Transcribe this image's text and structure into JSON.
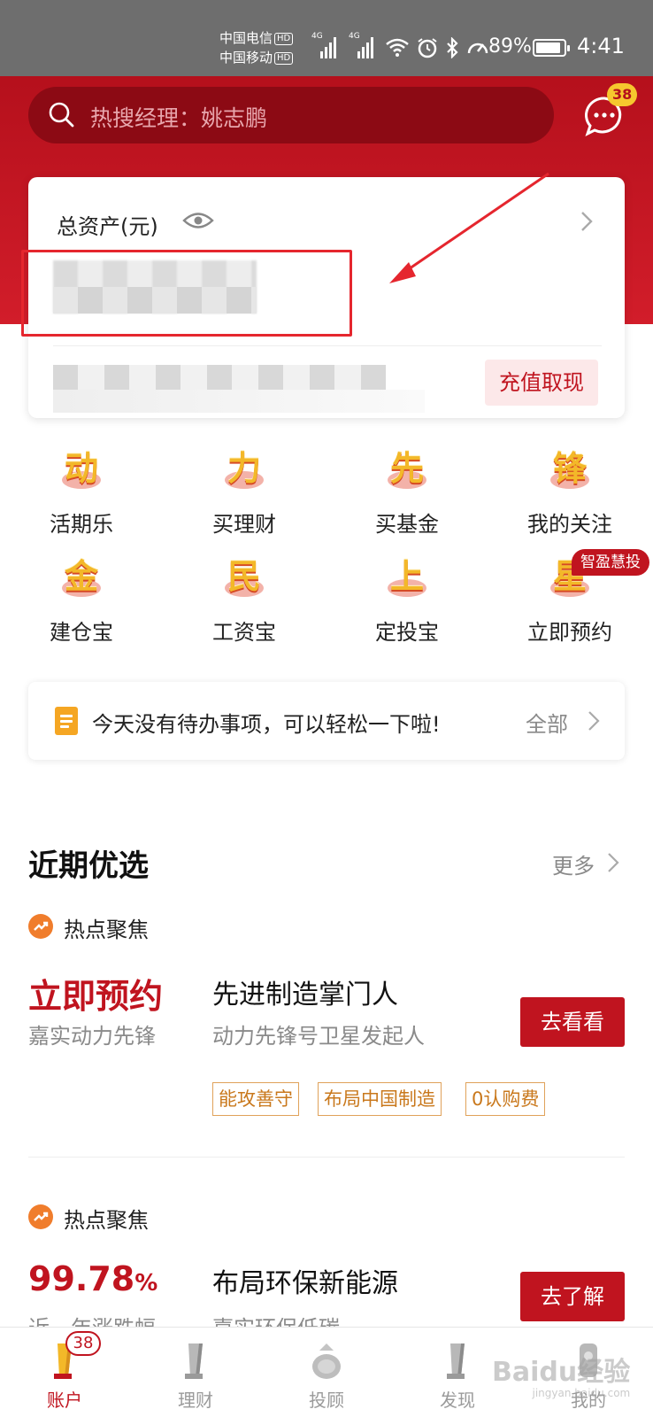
{
  "status_bar": {
    "carrier_1": "中国电信",
    "carrier_2": "中国移动",
    "hd_badge": "HD",
    "network": "4G",
    "battery_pct": "89%",
    "battery_level": 0.89,
    "time": "4:41"
  },
  "header": {
    "search_placeholder": "热搜经理：姚志鹏",
    "message_badge": "38",
    "bg_color": "#c4141f"
  },
  "asset_card": {
    "title": "总资产(元)",
    "recharge_label": "充值取现"
  },
  "shortcuts": [
    {
      "glyph": "动",
      "label": "活期乐"
    },
    {
      "glyph": "力",
      "label": "买理财"
    },
    {
      "glyph": "先",
      "label": "买基金"
    },
    {
      "glyph": "锋",
      "label": "我的关注"
    },
    {
      "glyph": "金",
      "label": "建仓宝"
    },
    {
      "glyph": "民",
      "label": "工资宝"
    },
    {
      "glyph": "上",
      "label": "定投宝"
    },
    {
      "glyph": "星",
      "label": "立即预约"
    }
  ],
  "shortcut_badge": "智盈慧投",
  "todo": {
    "text": "今天没有待办事项，可以轻松一下啦!",
    "all_label": "全部"
  },
  "recent": {
    "title": "近期优选",
    "more_label": "更多",
    "items": [
      {
        "category": "热点聚焦",
        "highlight": "立即预约",
        "highlight_sub": "嘉实动力先锋",
        "title": "先进制造掌门人",
        "subtitle": "动力先锋号卫星发起人",
        "tags": [
          "能攻善守",
          "布局中国制造",
          "0认购费"
        ],
        "button": "去看看"
      },
      {
        "category": "热点聚焦",
        "highlight_number": "99.78",
        "highlight_unit": "%",
        "highlight_sub": "近一年涨跌幅",
        "title": "布局环保新能源",
        "subtitle": "嘉实环保低碳",
        "button": "去了解"
      }
    ]
  },
  "tabbar": {
    "tabs": [
      {
        "label": "账户",
        "badge": "38"
      },
      {
        "label": "理财"
      },
      {
        "label": "投顾"
      },
      {
        "label": "发现"
      },
      {
        "label": "我的"
      }
    ],
    "active_color": "#c0141f"
  },
  "watermark": {
    "text": "Baidu经验",
    "url": "jingyan.baidu.com"
  }
}
